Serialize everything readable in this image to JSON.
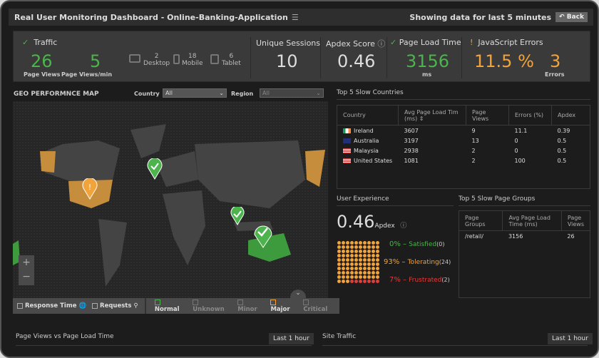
{
  "header": {
    "title": "Real User Monitoring Dashboard - Online-Banking-Application",
    "range_text": "Showing data for last 5 minutes",
    "back_label": "Back"
  },
  "kpi": {
    "traffic": {
      "label": "Traffic",
      "page_views": "26",
      "page_views_label": "Page Views",
      "per_min": "5",
      "per_min_label": "Page Views/min",
      "desktop": "2",
      "desktop_label": "Desktop",
      "mobile": "18",
      "mobile_label": "Mobile",
      "tablet": "6",
      "tablet_label": "Tablet"
    },
    "sessions": {
      "label": "Unique Sessions",
      "value": "10"
    },
    "apdex": {
      "label": "Apdex Score",
      "value": "0.46"
    },
    "load": {
      "label": "Page Load Time",
      "value": "3156",
      "unit": "ms"
    },
    "js": {
      "label": "JavaScript Errors",
      "pct": "11.5 %",
      "count": "3",
      "count_label": "Errors"
    }
  },
  "geo": {
    "title": "GEO PERFORMNCE MAP",
    "country_label": "Country",
    "country_value": "All",
    "region_label": "Region",
    "region_value": "All",
    "legend": {
      "response_time": "Response Time",
      "requests": "Requests",
      "normal": "Normal",
      "unknown": "Unknown",
      "minor": "Minor",
      "major": "Major",
      "critical": "Critical"
    }
  },
  "slow_countries": {
    "title": "Top 5 Slow Countries",
    "headers": [
      "Country",
      "Avg Page Load Tim (ms)",
      "Page Views",
      "Errors (%)",
      "Apdex"
    ],
    "rows": [
      [
        "Ireland",
        "3607",
        "9",
        "11.1",
        "0.39"
      ],
      [
        "Australia",
        "3197",
        "13",
        "0",
        "0.5"
      ],
      [
        "Malaysia",
        "2938",
        "2",
        "0",
        "0.5"
      ],
      [
        "United States",
        "1081",
        "2",
        "100",
        "0.5"
      ]
    ]
  },
  "user_experience": {
    "title": "User Experience",
    "apdex": "0.46",
    "apdex_label": "Apdex",
    "satisfied": {
      "pct": "0%",
      "label": "Satisfied",
      "count": "(0)"
    },
    "tolerating": {
      "pct": "93%",
      "label": "Tolerating",
      "count": "(24)"
    },
    "frustrated": {
      "pct": "7%",
      "label": "Frustrated",
      "count": "(2)"
    }
  },
  "slow_pages": {
    "title": "Top 5 Slow Page Groups",
    "headers": [
      "Page Groups",
      "Avg Page Load Time (ms)",
      "Page Views"
    ],
    "rows": [
      [
        "/retail/",
        "3156",
        "26"
      ]
    ]
  },
  "bottom": {
    "chart1_title": "Page Views vs Page Load Time",
    "chart1_range": "Last 1 hour",
    "chart2_title": "Site Traffic",
    "chart2_range": "Last 1 hour"
  },
  "colors": {
    "green": "#4db34d",
    "orange": "#f2a33a",
    "red": "#e03c3c"
  }
}
